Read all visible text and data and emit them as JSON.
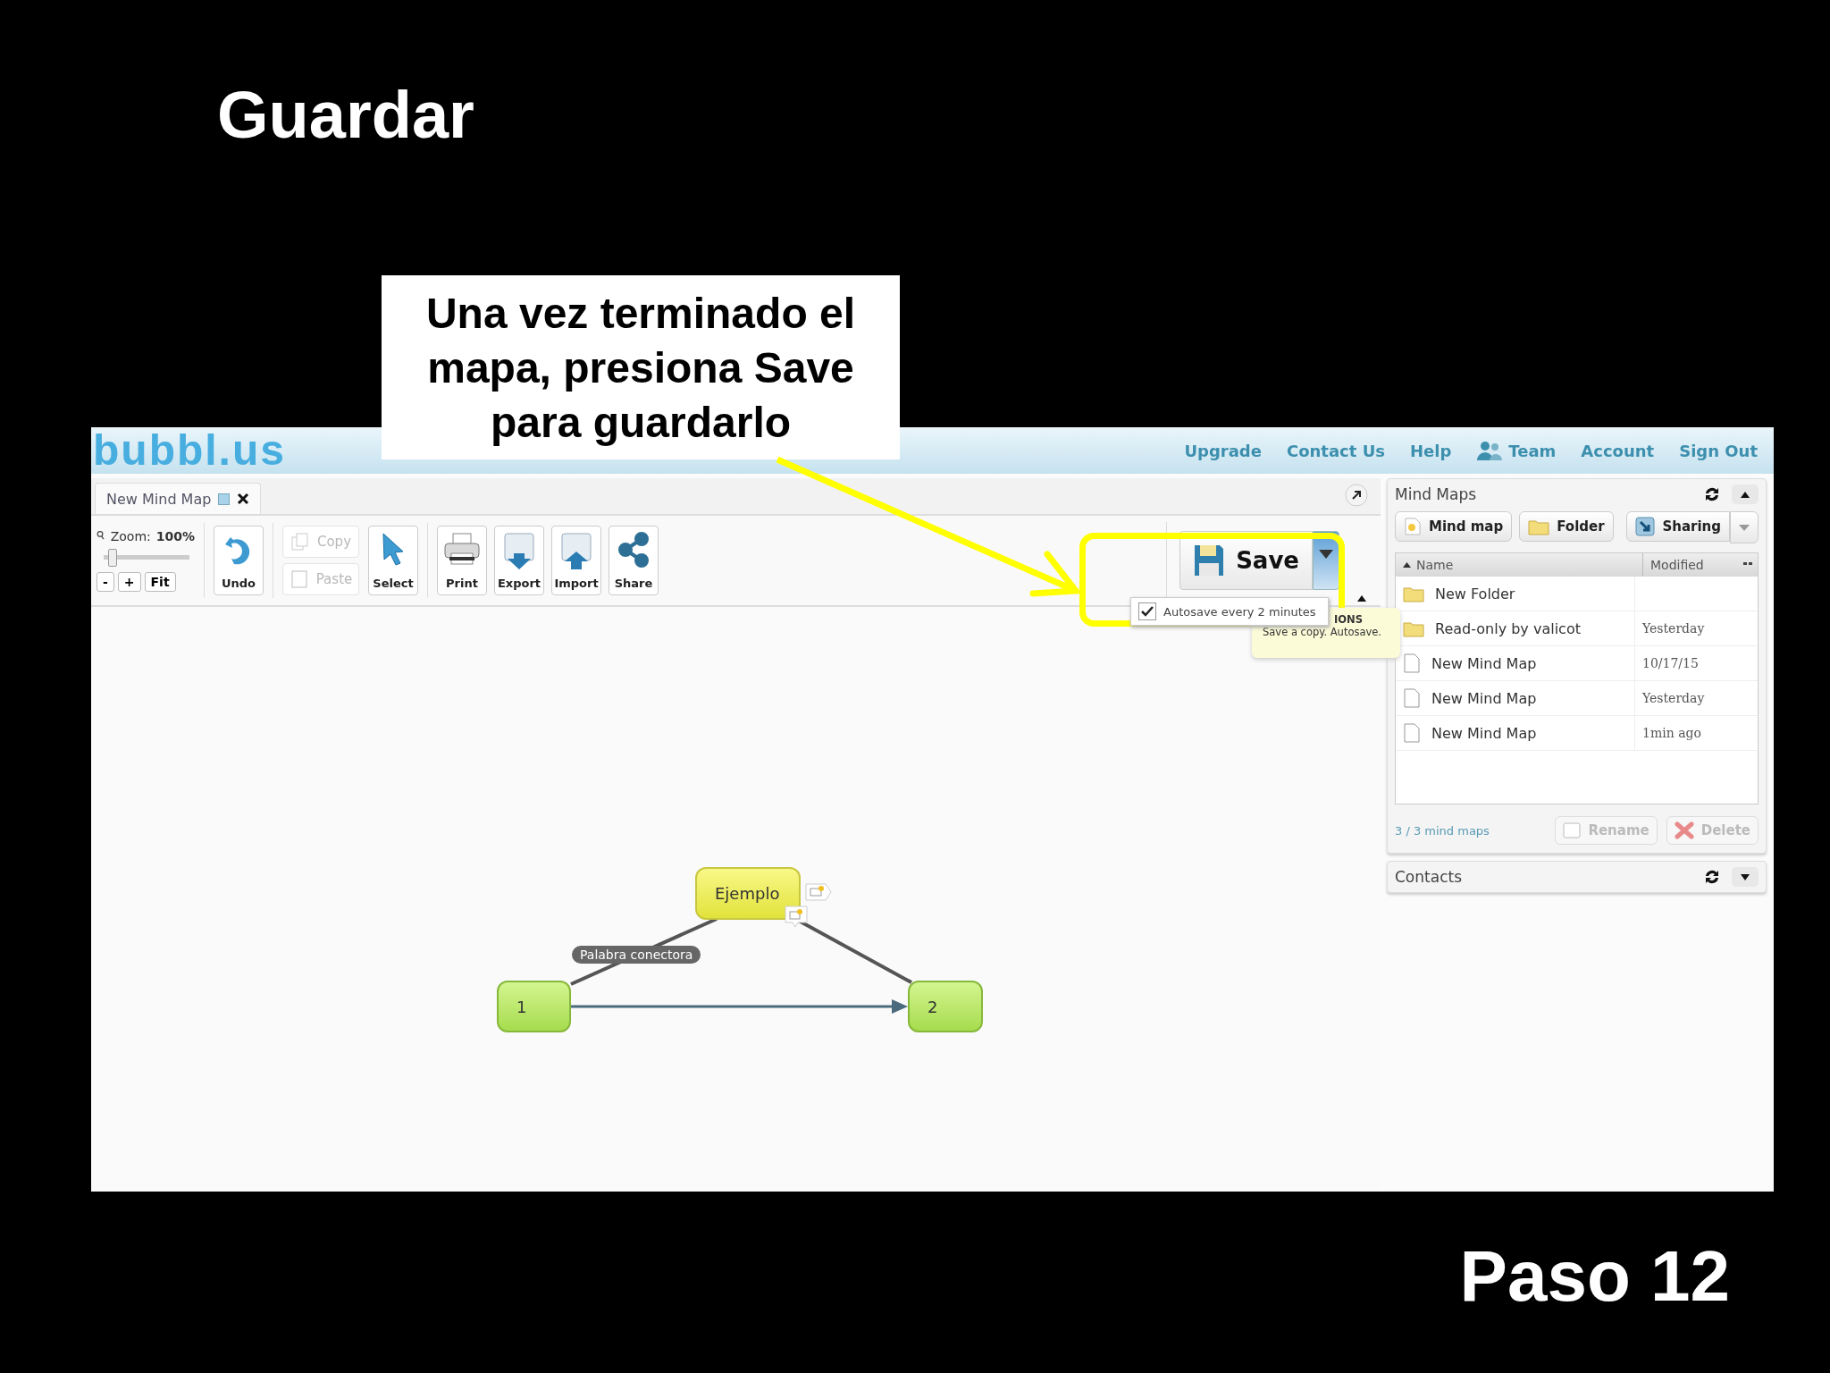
{
  "slide": {
    "title": "Guardar",
    "callout": "Una vez terminado el mapa, presiona Save para guardarlo",
    "step": "Paso 12"
  },
  "app": {
    "logo": "bubbl.us",
    "nav": [
      {
        "label": "Upgrade",
        "kind": "link"
      },
      {
        "label": "Contact Us",
        "kind": "link"
      },
      {
        "label": "Help",
        "kind": "link"
      },
      {
        "label": "Team",
        "kind": "team"
      },
      {
        "label": "Account",
        "kind": "link"
      },
      {
        "label": "Sign Out",
        "kind": "link"
      }
    ]
  },
  "tabs": [
    {
      "label": "New Mind Map",
      "selected": true
    }
  ],
  "toolbar": {
    "zoom_label": "Zoom:",
    "zoom_value": "100%",
    "zoom": {
      "level": 0.1
    },
    "zoom_buttons": [
      "-",
      "+",
      "Fit"
    ],
    "groups": [
      {
        "kind": "row",
        "tools": [
          {
            "label": "Undo",
            "kind": "undo",
            "disabled": false
          }
        ]
      },
      {
        "kind": "stack",
        "tools": [
          {
            "label": "Copy",
            "kind": "copy",
            "disabled": true
          },
          {
            "label": "Paste",
            "kind": "paste",
            "disabled": true
          }
        ]
      },
      {
        "kind": "row",
        "tools": [
          {
            "label": "Select",
            "kind": "select",
            "disabled": false
          }
        ]
      },
      {
        "kind": "row",
        "tools": [
          {
            "label": "Print",
            "kind": "print",
            "disabled": false
          },
          {
            "label": "Export",
            "kind": "export",
            "disabled": false
          },
          {
            "label": "Import",
            "kind": "import",
            "disabled": false
          },
          {
            "label": "Share",
            "kind": "share",
            "disabled": false
          }
        ]
      }
    ]
  },
  "save": {
    "label": "Save",
    "autosave": {
      "label": "Autosave every 2 minutes",
      "checked": true
    }
  },
  "tooltip": {
    "title": "IONS",
    "text": "Save a copy. Autosave."
  },
  "mind_map": {
    "nodes": [
      {
        "label": "Ejemplo",
        "kind": "central"
      },
      {
        "label": "1",
        "kind": "topic"
      },
      {
        "label": "2",
        "kind": "topic"
      }
    ],
    "connector_label": "Palabra conectora"
  },
  "mind_maps_panel": {
    "title": "Mind Maps",
    "buttons": [
      {
        "label": "Mind map",
        "kind": "map"
      },
      {
        "label": "Folder",
        "kind": "folder"
      },
      {
        "label": "Sharing",
        "kind": "sharing"
      }
    ],
    "columns": [
      "Name",
      "Modified"
    ],
    "rows": [
      {
        "name": "New Folder",
        "kind": "folder"
      },
      {
        "name": "Read-only by valicot",
        "modified": "Yesterday",
        "kind": "folder"
      },
      {
        "name": "New Mind Map",
        "modified": "10/17/15",
        "kind": "file"
      },
      {
        "name": "New Mind Map",
        "modified": "Yesterday",
        "kind": "file"
      },
      {
        "name": "New Mind Map",
        "modified": "1min ago",
        "kind": "file"
      }
    ],
    "count": "3 / 3 mind maps",
    "actions": [
      {
        "label": "Rename",
        "kind": "rename",
        "disabled": true
      },
      {
        "label": "Delete",
        "kind": "delete",
        "disabled": true
      }
    ]
  },
  "contacts_panel": {
    "title": "Contacts"
  }
}
